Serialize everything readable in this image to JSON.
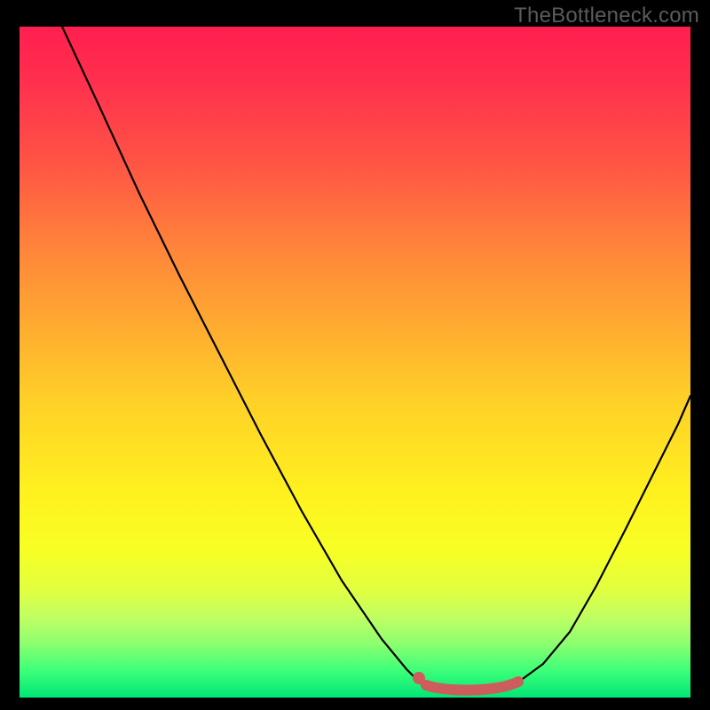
{
  "watermark": "TheBottleneck.com",
  "chart_data": {
    "type": "line",
    "title": "",
    "xlabel": "",
    "ylabel": "",
    "xlim": [
      0,
      100
    ],
    "ylim": [
      0,
      100
    ],
    "grid": false,
    "legend": false,
    "series": [
      {
        "name": "left-branch",
        "x": [
          6,
          12,
          18,
          24,
          30,
          36,
          42,
          48,
          54,
          58,
          60
        ],
        "values": [
          100,
          88,
          75,
          63,
          51,
          39,
          28,
          18,
          9,
          4,
          2
        ]
      },
      {
        "name": "right-branch",
        "x": [
          74,
          78,
          82,
          86,
          90,
          94,
          98,
          100
        ],
        "values": [
          2,
          5,
          10,
          17,
          25,
          33,
          41,
          45
        ]
      },
      {
        "name": "optimal-zone",
        "x": [
          60,
          64,
          68,
          72,
          74
        ],
        "values": [
          2,
          1,
          1,
          1,
          2
        ]
      }
    ],
    "annotations": [
      {
        "name": "optimal-start-dot",
        "x": 60,
        "y": 2
      }
    ],
    "colors": {
      "curve": "#000000",
      "highlight": "#cd5c5c",
      "gradient_top": "#ff1f4f",
      "gradient_bottom": "#00e676"
    }
  }
}
